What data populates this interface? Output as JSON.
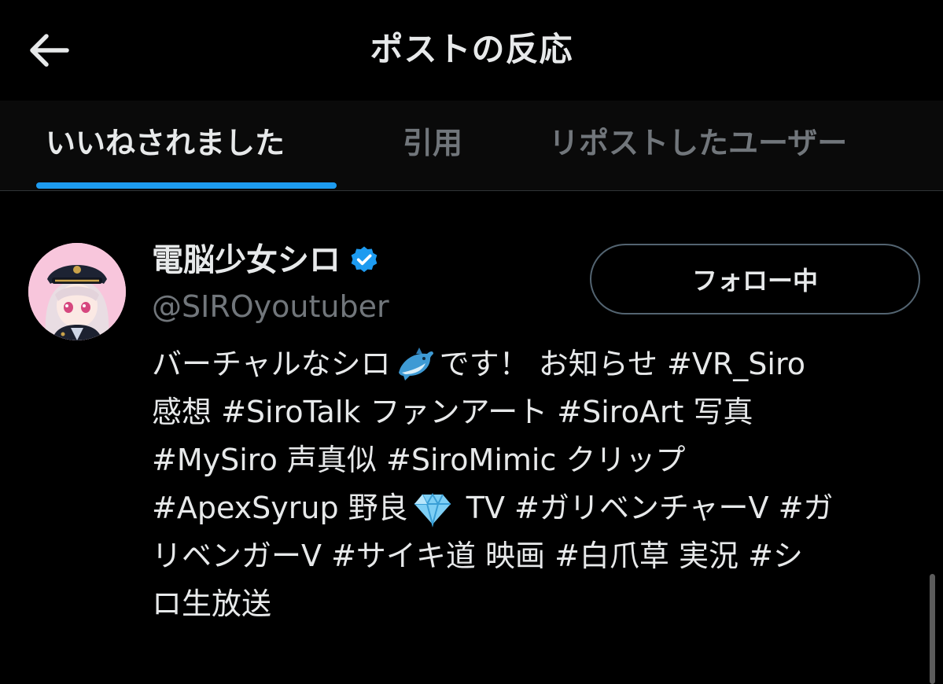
{
  "header": {
    "title": "ポストの反応",
    "back_icon": "arrow-left-icon"
  },
  "tabs": [
    {
      "label": "いいねされました",
      "active": true
    },
    {
      "label": "引用",
      "active": false
    },
    {
      "label": "リポストしたユーザー",
      "active": false
    }
  ],
  "colors": {
    "background": "#000000",
    "text": "#e7e9ea",
    "muted": "#71767b",
    "accent": "#1d9bf0"
  },
  "user": {
    "display_name": "電脳少女シロ",
    "verified_icon": "verified-badge-icon",
    "handle": "@SIROyoutuber",
    "follow_label": "フォロー中",
    "bio_lines": [
      {
        "before": "バーチャルなシロ",
        "emoji": "dolphin-emoji",
        "after": "です！ お知らせ #VR_Siro"
      },
      {
        "before": "感想 #SiroTalk ファンアート #SiroArt 写真",
        "emoji": "",
        "after": ""
      },
      {
        "before": "#MySiro 声真似 #SiroMimic クリップ",
        "emoji": "",
        "after": ""
      },
      {
        "before": "#ApexSyrup 野良",
        "emoji": "gem-emoji",
        "after": " TV #ガリベンチャーV #ガ"
      },
      {
        "before": "リベンガーV #サイキ道 映画 #白爪草 実況 #シ",
        "emoji": "",
        "after": ""
      },
      {
        "before": "ロ生放送",
        "emoji": "",
        "after": ""
      }
    ]
  }
}
